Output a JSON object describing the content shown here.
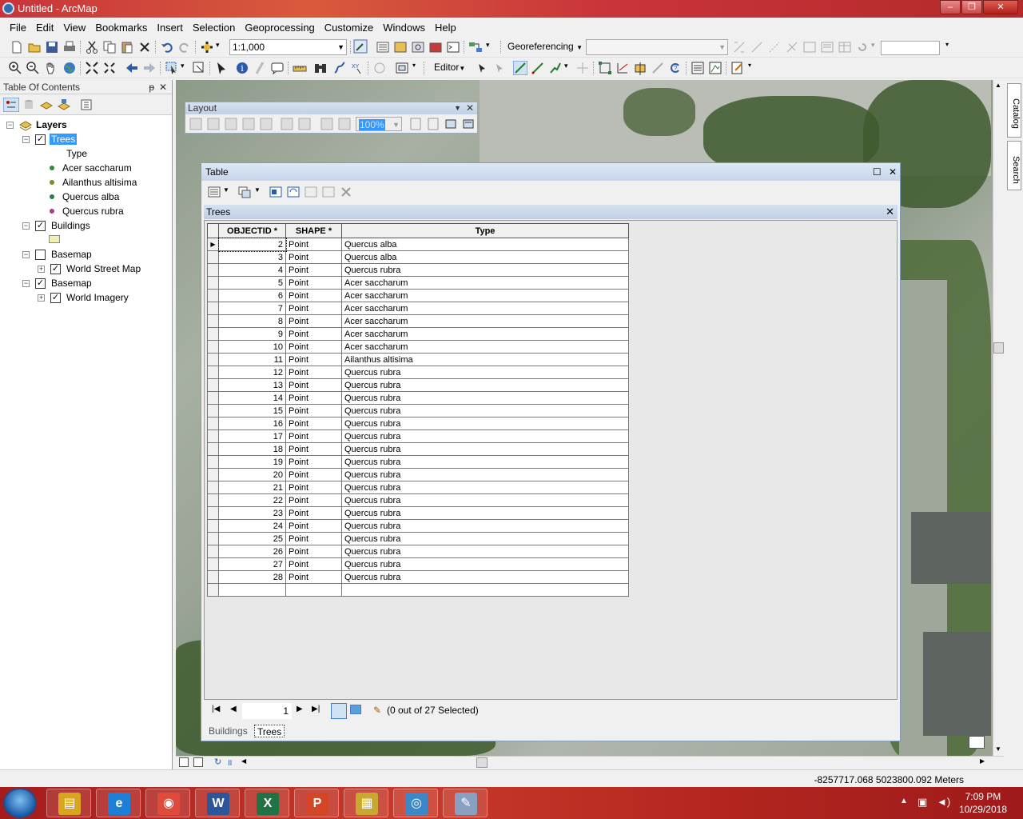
{
  "window": {
    "title": "Untitled - ArcMap",
    "min": "–",
    "max": "❐",
    "close": "✕"
  },
  "menu": [
    "File",
    "Edit",
    "View",
    "Bookmarks",
    "Insert",
    "Selection",
    "Geoprocessing",
    "Customize",
    "Windows",
    "Help"
  ],
  "toolbar": {
    "scale": "1:1,000",
    "georeferencing": "Georeferencing",
    "editor": "Editor"
  },
  "toc": {
    "title": "Table Of Contents",
    "pin": "ᵽ",
    "close": "✕",
    "root": "Layers",
    "trees_layer": "Trees",
    "trees_field": "Type",
    "tree_classes": [
      {
        "label": "Acer saccharum",
        "color": "#2e8b3e"
      },
      {
        "label": "Ailanthus altisima",
        "color": "#7c8a2a"
      },
      {
        "label": "Quercus alba",
        "color": "#2a7a4a"
      },
      {
        "label": "Quercus rubra",
        "color": "#a33a8a"
      }
    ],
    "buildings_layer": "Buildings",
    "buildings_fill": "#f2f0b0",
    "basemap1": "Basemap",
    "basemap1_child": "World Street Map",
    "basemap2": "Basemap",
    "basemap2_child": "World Imagery"
  },
  "layout_toolbar": {
    "title": "Layout",
    "zoom": "100%"
  },
  "table": {
    "window_title": "Table",
    "sub_title": "Trees",
    "columns": [
      "OBJECTID *",
      "SHAPE *",
      "Type"
    ],
    "rows": [
      [
        "2",
        "Point",
        "Quercus alba"
      ],
      [
        "3",
        "Point",
        "Quercus alba"
      ],
      [
        "4",
        "Point",
        "Quercus rubra"
      ],
      [
        "5",
        "Point",
        "Acer saccharum"
      ],
      [
        "6",
        "Point",
        "Acer saccharum"
      ],
      [
        "7",
        "Point",
        "Acer saccharum"
      ],
      [
        "8",
        "Point",
        "Acer saccharum"
      ],
      [
        "9",
        "Point",
        "Acer saccharum"
      ],
      [
        "10",
        "Point",
        "Acer saccharum"
      ],
      [
        "11",
        "Point",
        "Ailanthus altisima"
      ],
      [
        "12",
        "Point",
        "Quercus rubra"
      ],
      [
        "13",
        "Point",
        "Quercus rubra"
      ],
      [
        "14",
        "Point",
        "Quercus rubra"
      ],
      [
        "15",
        "Point",
        "Quercus rubra"
      ],
      [
        "16",
        "Point",
        "Quercus rubra"
      ],
      [
        "17",
        "Point",
        "Quercus rubra"
      ],
      [
        "18",
        "Point",
        "Quercus rubra"
      ],
      [
        "19",
        "Point",
        "Quercus rubra"
      ],
      [
        "20",
        "Point",
        "Quercus rubra"
      ],
      [
        "21",
        "Point",
        "Quercus rubra"
      ],
      [
        "22",
        "Point",
        "Quercus rubra"
      ],
      [
        "23",
        "Point",
        "Quercus rubra"
      ],
      [
        "24",
        "Point",
        "Quercus rubra"
      ],
      [
        "25",
        "Point",
        "Quercus rubra"
      ],
      [
        "26",
        "Point",
        "Quercus rubra"
      ],
      [
        "27",
        "Point",
        "Quercus rubra"
      ],
      [
        "28",
        "Point",
        "Quercus rubra"
      ]
    ],
    "current_record": "1",
    "selection_status": "(0 out of 27 Selected)",
    "tabs": [
      "Buildings",
      "Trees"
    ]
  },
  "status": {
    "coords": "-8257717.068  5023800.092 Meters"
  },
  "right_tabs": [
    "Catalog",
    "Search"
  ],
  "taskbar": {
    "apps": [
      {
        "name": "file-explorer",
        "glyph": "▤",
        "color": "#d9a520"
      },
      {
        "name": "internet-explorer",
        "glyph": "e",
        "color": "#1e7fd6"
      },
      {
        "name": "chrome",
        "glyph": "◉",
        "color": "#e04a3a"
      },
      {
        "name": "word",
        "glyph": "W",
        "color": "#2b579a"
      },
      {
        "name": "excel",
        "glyph": "X",
        "color": "#217346"
      },
      {
        "name": "powerpoint",
        "glyph": "P",
        "color": "#d24726"
      },
      {
        "name": "arccatalog",
        "glyph": "▦",
        "color": "#c9a830"
      },
      {
        "name": "arcmap",
        "glyph": "◎",
        "color": "#3a88c8"
      },
      {
        "name": "paint",
        "glyph": "✎",
        "color": "#8aa0c0"
      }
    ],
    "time": "7:09 PM",
    "date": "10/29/2018"
  }
}
